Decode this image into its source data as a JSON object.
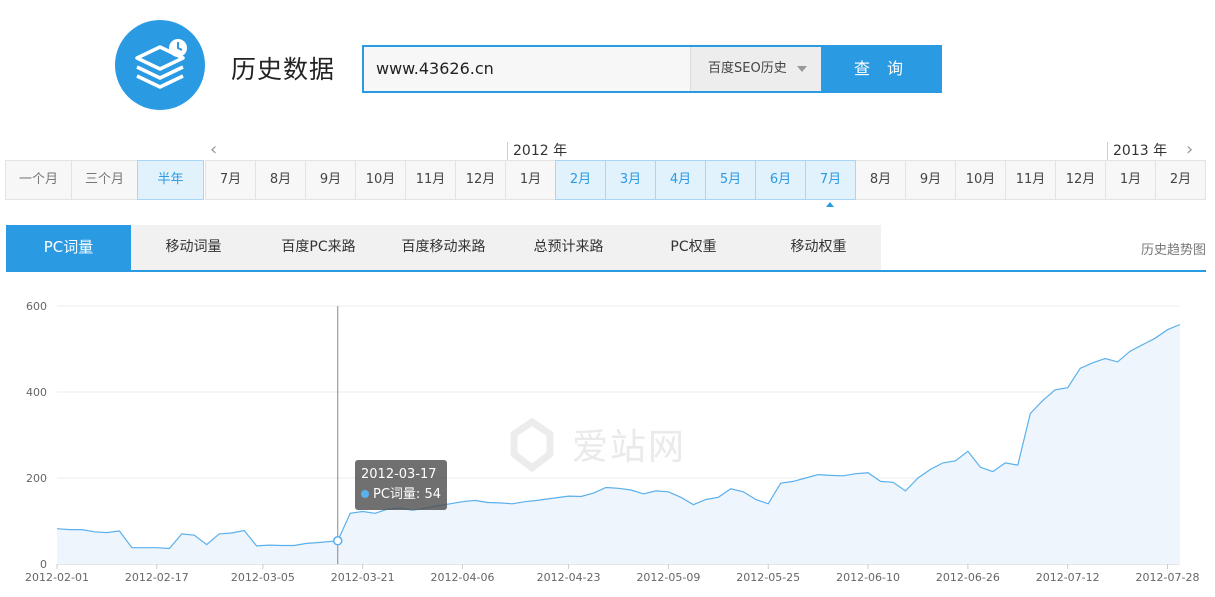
{
  "header": {
    "title": "历史数据",
    "logo_icon": "stacked-layers-clock-icon",
    "accent_color": "#2a9ae3"
  },
  "search": {
    "value": "www.43626.cn",
    "select_value": "百度SEO历史",
    "button_label": "查 询"
  },
  "range_buttons": [
    "一个月",
    "三个月",
    "半年"
  ],
  "range_active": "半年",
  "years": {
    "first": "2012 年",
    "second": "2013 年"
  },
  "months": [
    "7月",
    "8月",
    "9月",
    "10月",
    "11月",
    "12月",
    "1月",
    "2月",
    "3月",
    "4月",
    "5月",
    "6月",
    "7月",
    "8月",
    "9月",
    "10月",
    "11月",
    "12月",
    "1月",
    "2月"
  ],
  "tabs": [
    "PC词量",
    "移动词量",
    "百度PC来路",
    "百度移动来路",
    "总预计来路",
    "PC权重",
    "移动权重"
  ],
  "tabs_right": "历史趋势图",
  "watermark": "爱站网",
  "tooltip": {
    "date": "2012-03-17",
    "series": "PC词量",
    "value_text": "54"
  },
  "chart_data": {
    "type": "area",
    "title": "",
    "xlabel": "",
    "ylabel": "",
    "ylim": [
      0,
      600
    ],
    "yticks": [
      0,
      200,
      400,
      600
    ],
    "xticks": [
      "2012-02-01",
      "2012-02-17",
      "2012-03-05",
      "2012-03-21",
      "2012-04-06",
      "2012-04-23",
      "2012-05-09",
      "2012-05-25",
      "2012-06-10",
      "2012-06-26",
      "2012-07-12",
      "2012-07-28"
    ],
    "series": [
      {
        "name": "PC词量",
        "color": "#5ab0ec",
        "fill": "#eef5fc",
        "points": [
          [
            "2012-02-01",
            82
          ],
          [
            "2012-02-03",
            80
          ],
          [
            "2012-02-05",
            80
          ],
          [
            "2012-02-07",
            75
          ],
          [
            "2012-02-09",
            73
          ],
          [
            "2012-02-11",
            77
          ],
          [
            "2012-02-13",
            38
          ],
          [
            "2012-02-15",
            38
          ],
          [
            "2012-02-17",
            38
          ],
          [
            "2012-02-19",
            36
          ],
          [
            "2012-02-21",
            70
          ],
          [
            "2012-02-23",
            67
          ],
          [
            "2012-02-25",
            45
          ],
          [
            "2012-02-27",
            70
          ],
          [
            "2012-02-29",
            72
          ],
          [
            "2012-03-02",
            78
          ],
          [
            "2012-03-04",
            42
          ],
          [
            "2012-03-06",
            44
          ],
          [
            "2012-03-08",
            43
          ],
          [
            "2012-03-10",
            43
          ],
          [
            "2012-03-12",
            48
          ],
          [
            "2012-03-14",
            50
          ],
          [
            "2012-03-17",
            54
          ],
          [
            "2012-03-19",
            118
          ],
          [
            "2012-03-21",
            122
          ],
          [
            "2012-03-23",
            118
          ],
          [
            "2012-03-25",
            128
          ],
          [
            "2012-03-27",
            130
          ],
          [
            "2012-03-29",
            125
          ],
          [
            "2012-03-31",
            130
          ],
          [
            "2012-04-02",
            135
          ],
          [
            "2012-04-04",
            140
          ],
          [
            "2012-04-06",
            145
          ],
          [
            "2012-04-08",
            148
          ],
          [
            "2012-04-10",
            143
          ],
          [
            "2012-04-12",
            142
          ],
          [
            "2012-04-14",
            140
          ],
          [
            "2012-04-16",
            145
          ],
          [
            "2012-04-18",
            148
          ],
          [
            "2012-04-20",
            152
          ],
          [
            "2012-04-23",
            158
          ],
          [
            "2012-04-25",
            157
          ],
          [
            "2012-04-27",
            165
          ],
          [
            "2012-04-29",
            178
          ],
          [
            "2012-05-01",
            176
          ],
          [
            "2012-05-03",
            172
          ],
          [
            "2012-05-05",
            163
          ],
          [
            "2012-05-07",
            170
          ],
          [
            "2012-05-09",
            168
          ],
          [
            "2012-05-11",
            155
          ],
          [
            "2012-05-13",
            138
          ],
          [
            "2012-05-15",
            150
          ],
          [
            "2012-05-17",
            155
          ],
          [
            "2012-05-19",
            175
          ],
          [
            "2012-05-21",
            168
          ],
          [
            "2012-05-23",
            150
          ],
          [
            "2012-05-25",
            140
          ],
          [
            "2012-05-27",
            188
          ],
          [
            "2012-05-29",
            192
          ],
          [
            "2012-05-31",
            200
          ],
          [
            "2012-06-02",
            208
          ],
          [
            "2012-06-04",
            206
          ],
          [
            "2012-06-06",
            205
          ],
          [
            "2012-06-08",
            210
          ],
          [
            "2012-06-10",
            212
          ],
          [
            "2012-06-12",
            192
          ],
          [
            "2012-06-14",
            190
          ],
          [
            "2012-06-16",
            170
          ],
          [
            "2012-06-18",
            200
          ],
          [
            "2012-06-20",
            220
          ],
          [
            "2012-06-22",
            235
          ],
          [
            "2012-06-24",
            240
          ],
          [
            "2012-06-26",
            262
          ],
          [
            "2012-06-28",
            225
          ],
          [
            "2012-06-30",
            215
          ],
          [
            "2012-07-02",
            235
          ],
          [
            "2012-07-04",
            230
          ],
          [
            "2012-07-06",
            350
          ],
          [
            "2012-07-08",
            380
          ],
          [
            "2012-07-10",
            405
          ],
          [
            "2012-07-12",
            410
          ],
          [
            "2012-07-14",
            455
          ],
          [
            "2012-07-16",
            468
          ],
          [
            "2012-07-18",
            478
          ],
          [
            "2012-07-20",
            470
          ],
          [
            "2012-07-22",
            495
          ],
          [
            "2012-07-24",
            510
          ],
          [
            "2012-07-26",
            525
          ],
          [
            "2012-07-28",
            545
          ],
          [
            "2012-07-30",
            557
          ]
        ]
      }
    ]
  }
}
